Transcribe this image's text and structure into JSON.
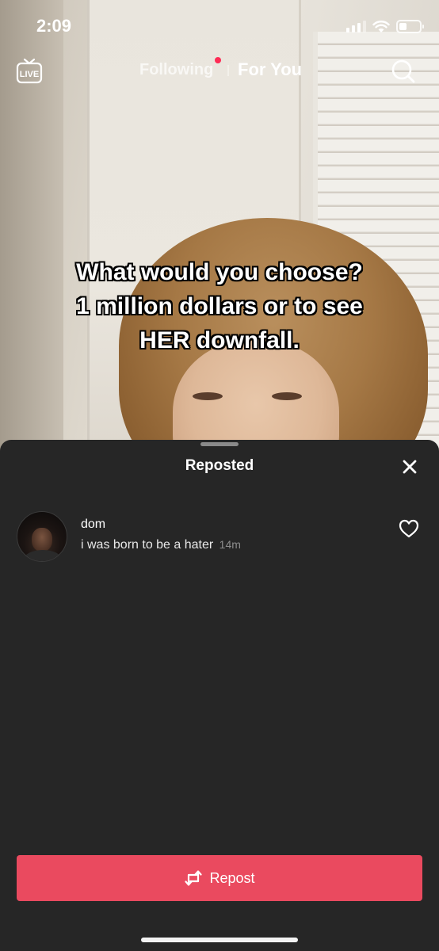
{
  "status_bar": {
    "time": "2:09"
  },
  "nav": {
    "live_label": "LIVE",
    "following_label": "Following",
    "for_you_label": "For You"
  },
  "video": {
    "caption_lines": [
      "What would you choose?",
      "1 million dollars or to see",
      "HER downfall."
    ]
  },
  "sheet": {
    "title": "Reposted",
    "entries": [
      {
        "name": "dom",
        "text": "i was born to be a hater",
        "time": "14m"
      }
    ],
    "repost_button_label": "Repost"
  },
  "colors": {
    "accent": "#ea4a5f",
    "notification_dot": "#fe2c55",
    "sheet_background": "#262626"
  },
  "icons": [
    "live-icon",
    "search-icon",
    "close-icon",
    "heart-icon",
    "repost-icon",
    "wifi-icon",
    "signal-icon",
    "battery-icon"
  ]
}
